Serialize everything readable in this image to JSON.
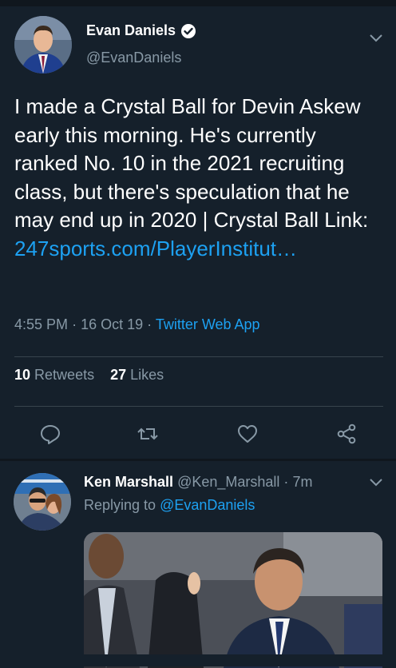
{
  "tweet": {
    "author": {
      "display_name": "Evan Daniels",
      "handle": "@EvanDaniels",
      "verified": true
    },
    "text_plain": "I made a Crystal Ball for Devin Askew early this morning. He's currently ranked No. 10 in the 2021 recruiting class, but there's speculation that he may end up in 2020 | Crystal Ball Link: ",
    "text_link": "247sports.com/PlayerInstitut…",
    "time": "4:55 PM",
    "date": "16 Oct 19",
    "source": "Twitter Web App",
    "retweets_count": "10",
    "retweets_label": "Retweets",
    "likes_count": "27",
    "likes_label": "Likes",
    "actions": [
      "reply-icon",
      "retweet-icon",
      "like-icon",
      "share-icon"
    ]
  },
  "reply": {
    "display_name": "Ken Marshall",
    "handle": "@Ken_Marshall",
    "age": "7m",
    "replying_prefix": "Replying to",
    "replying_to": "@EvanDaniels"
  },
  "colors": {
    "background": "#15202b",
    "text_secondary": "#8899a6",
    "accent": "#1da1f2",
    "divider": "#38444d"
  }
}
